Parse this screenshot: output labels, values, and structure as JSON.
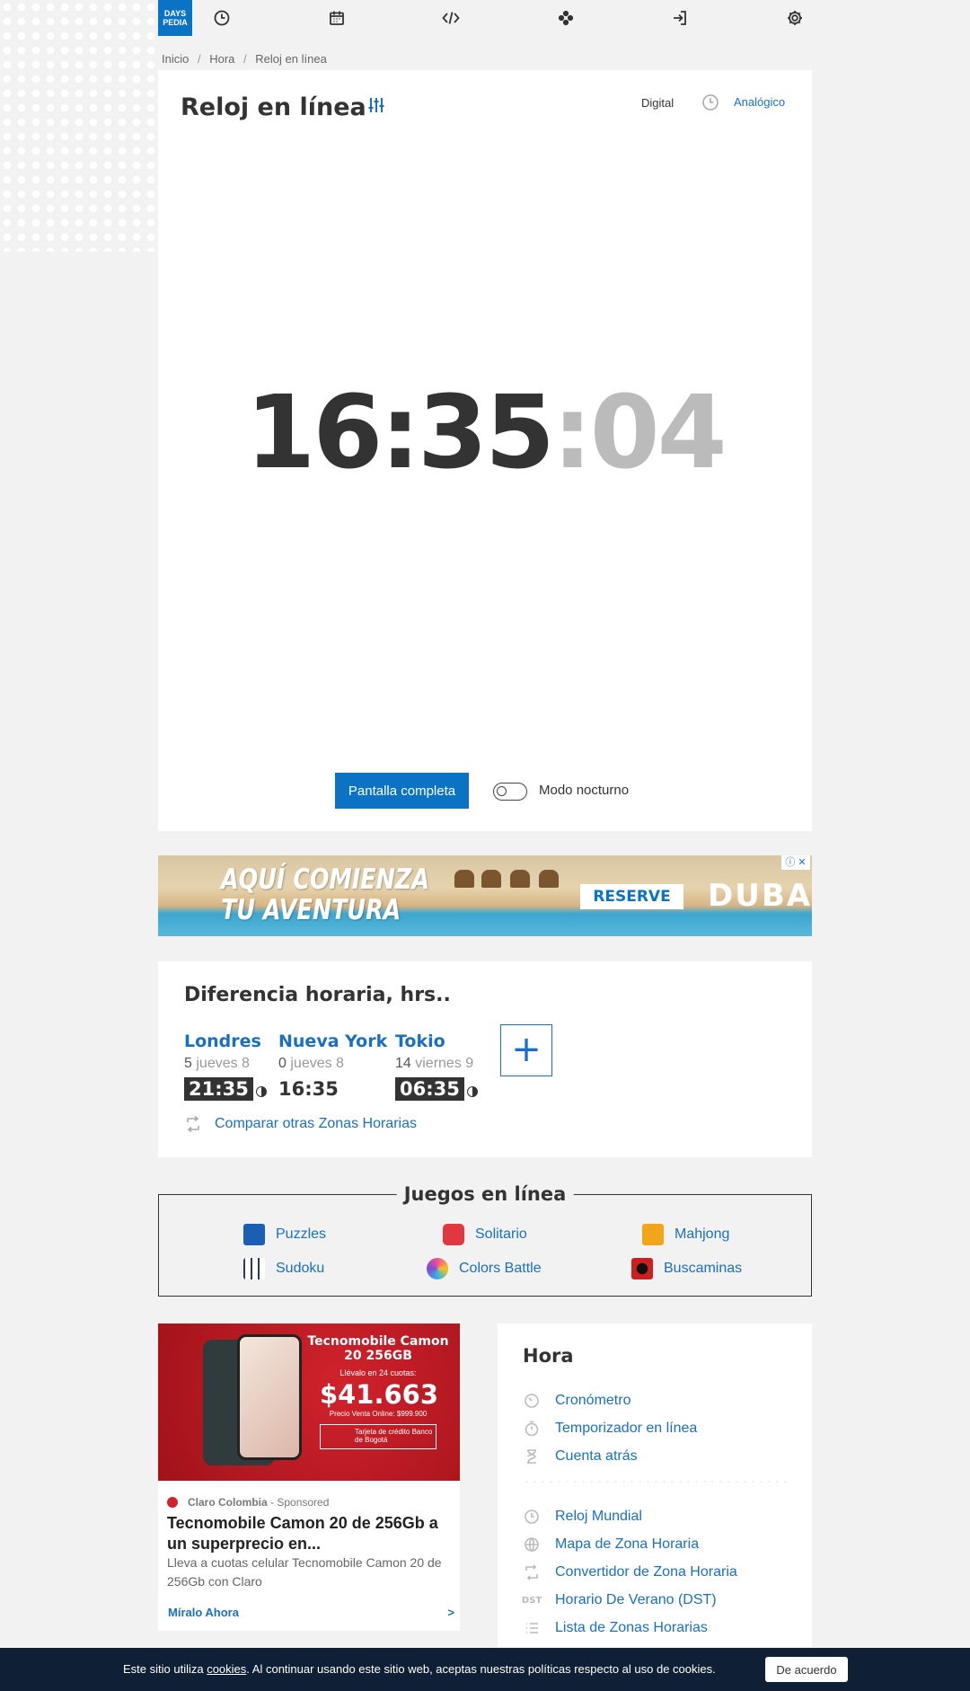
{
  "logo": {
    "line1": "DAYS",
    "line2": "PEDIA"
  },
  "nav": {
    "icons": [
      "clock-icon",
      "calendar-icon",
      "code-icon",
      "gamepad-icon",
      "login-icon",
      "gear-icon"
    ]
  },
  "breadcrumb": [
    {
      "label": "Inicio"
    },
    {
      "label": "Hora"
    },
    {
      "label": "Reloj en línea"
    }
  ],
  "breadcrumb_sep": "/",
  "clock": {
    "title": "Reloj en línea",
    "mode_digital": "Digital",
    "mode_analog": "Analógico",
    "time_hm": "16:35",
    "time_sec": ":04",
    "fullscreen_label": "Pantalla completa",
    "night_mode_label": "Modo nocturno",
    "night_mode_on": false
  },
  "banner_ad": {
    "headline_1": "AQUÍ COMIENZA",
    "headline_2": "TU AVENTURA",
    "button": "RESERVE",
    "brand": "DUBAI"
  },
  "time_diff": {
    "title": "Diferencia horaria, hrs..",
    "cities": [
      {
        "name": "Londres",
        "offset": "5",
        "day": "jueves 8",
        "time": "21:35",
        "dark": true
      },
      {
        "name": "Nueva York",
        "offset": "0",
        "day": "jueves 8",
        "time": "16:35",
        "dark": false
      },
      {
        "name": "Tokio",
        "offset": "14",
        "day": "viernes 9",
        "time": "06:35",
        "dark": true
      }
    ],
    "add_label": "+",
    "compare_label": "Comparar otras Zonas Horarias"
  },
  "games": {
    "title": "Juegos en línea",
    "items": [
      {
        "label": "Puzzles",
        "color": "#1a5fb4"
      },
      {
        "label": "Solitario",
        "color": "#e0383e"
      },
      {
        "label": "Mahjong",
        "color": "#f2a51a"
      },
      {
        "label": "Sudoku",
        "color": "#2b3a5c"
      },
      {
        "label": "Colors Battle",
        "color": "#f04e98"
      },
      {
        "label": "Buscaminas",
        "color": "#cc1f1f"
      }
    ]
  },
  "sponsored": {
    "img_title": "Tecnomobile Camon 20 256GB",
    "img_sub": "Llévalo en 24 cuotas:",
    "img_price": "$41.663",
    "img_price_note": "Precio Venta Online: $999.900",
    "img_card": "Tarjeta de crédito Banco de Bogotá",
    "source": "Claro Colombia",
    "sponsored": "Sponsored",
    "headline": "Tecnomobile Camon 20 de 256Gb a un superprecio en...",
    "description": "Lleva a cuotas celular Tecnomobile Camon 20 de 256Gb con Claro",
    "cta": "Míralo Ahora",
    "arrow": ">"
  },
  "hora": {
    "title": "Hora",
    "links_top": [
      {
        "label": "Cronómetro",
        "icon": "stopwatch-icon"
      },
      {
        "label": "Temporizador en línea",
        "icon": "timer-icon"
      },
      {
        "label": "Cuenta atrás",
        "icon": "hourglass-icon"
      }
    ],
    "links_bottom": [
      {
        "label": "Reloj Mundial",
        "icon": "clock-icon"
      },
      {
        "label": "Mapa de Zona Horaria",
        "icon": "globe-icon"
      },
      {
        "label": "Convertidor de Zona Horaria",
        "icon": "convert-icon"
      },
      {
        "label": "Horario De Verano (DST)",
        "icon": "dst-icon",
        "text_icon": "DST"
      },
      {
        "label": "Lista de Zonas Horarias",
        "icon": "list-icon"
      }
    ]
  },
  "cookie": {
    "text_before": "Este sitio utiliza ",
    "link": "cookies",
    "text_after": ". Al continuar usando este sitio web, aceptas nuestras políticas respecto al uso de cookies.",
    "button": "De acuerdo"
  }
}
